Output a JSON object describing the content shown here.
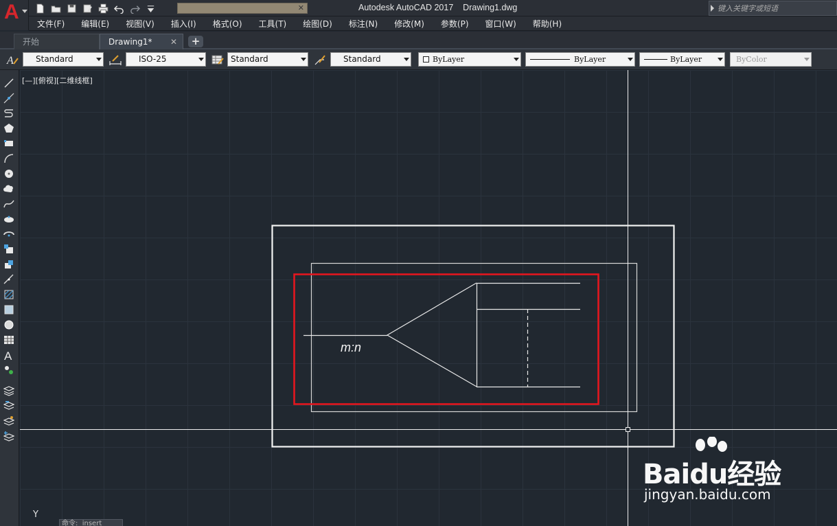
{
  "window": {
    "title": "Autodesk AutoCAD 2017    Drawing1.dwg",
    "search_placeholder": "键入关键字或短语",
    "title_placeholder_close": "✕"
  },
  "app_menu_icon": "autocad-a-icon",
  "quick_access": [
    "new-icon",
    "open-icon",
    "save-icon",
    "save-as-icon",
    "print-icon",
    "undo-icon",
    "redo-icon",
    "customize-icon"
  ],
  "menubar": {
    "items": [
      "文件(F)",
      "编辑(E)",
      "视图(V)",
      "插入(I)",
      "格式(O)",
      "工具(T)",
      "绘图(D)",
      "标注(N)",
      "修改(M)",
      "参数(P)",
      "窗口(W)",
      "帮助(H)"
    ]
  },
  "tabs": {
    "start": "开始",
    "drawing": "Drawing1*",
    "close": "✕",
    "add": "+"
  },
  "properties_toolbar": {
    "text_style": "Standard",
    "dim_style": "ISO-25",
    "table_style": "Standard",
    "multileader_style": "Standard",
    "color": "ByLayer",
    "linetype": "ByLayer",
    "lineweight": "ByLayer",
    "plot_style": "ByColor"
  },
  "left_toolbar": [
    "line-icon",
    "construction-line-icon",
    "polyline-icon",
    "polygon-icon",
    "rectangle-icon",
    "arc-icon",
    "circle-icon",
    "revision-cloud-icon",
    "spline-icon",
    "ellipse-icon",
    "ellipse-arc-icon",
    "insert-block-icon",
    "make-block-icon",
    "point-icon",
    "hatch-icon",
    "gradient-icon",
    "region-icon",
    "table-icon",
    "multiline-text-icon",
    "add-selected-icon",
    "layer-icon",
    "layer-previous-icon",
    "layer-isolate-icon",
    "layer-freeze-icon"
  ],
  "canvas": {
    "viewport_label": "[—][俯视][二维线框]",
    "annotation_text": "m:n",
    "ucs_axis": "Y",
    "command_line": "命令:  insert",
    "colors": {
      "background": "#212830",
      "lines": "#e8e8e8",
      "highlight": "#e3161e"
    }
  },
  "watermark": {
    "brand": "Baidu经验",
    "url": "jingyan.baidu.com"
  }
}
